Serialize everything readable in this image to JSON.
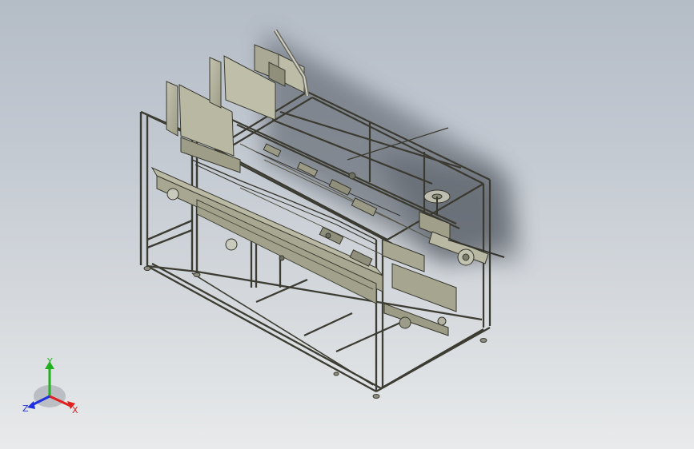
{
  "viewport": {
    "background_top": "#b4bcc6",
    "background_bottom": "#e8eaeb"
  },
  "model": {
    "icon": "packaging-machine-frame-3d-model"
  },
  "triad": {
    "x_label": "X",
    "y_label": "Y",
    "z_label": "Z",
    "x_color": "#e02020",
    "y_color": "#20b020",
    "z_color": "#2030e0"
  }
}
